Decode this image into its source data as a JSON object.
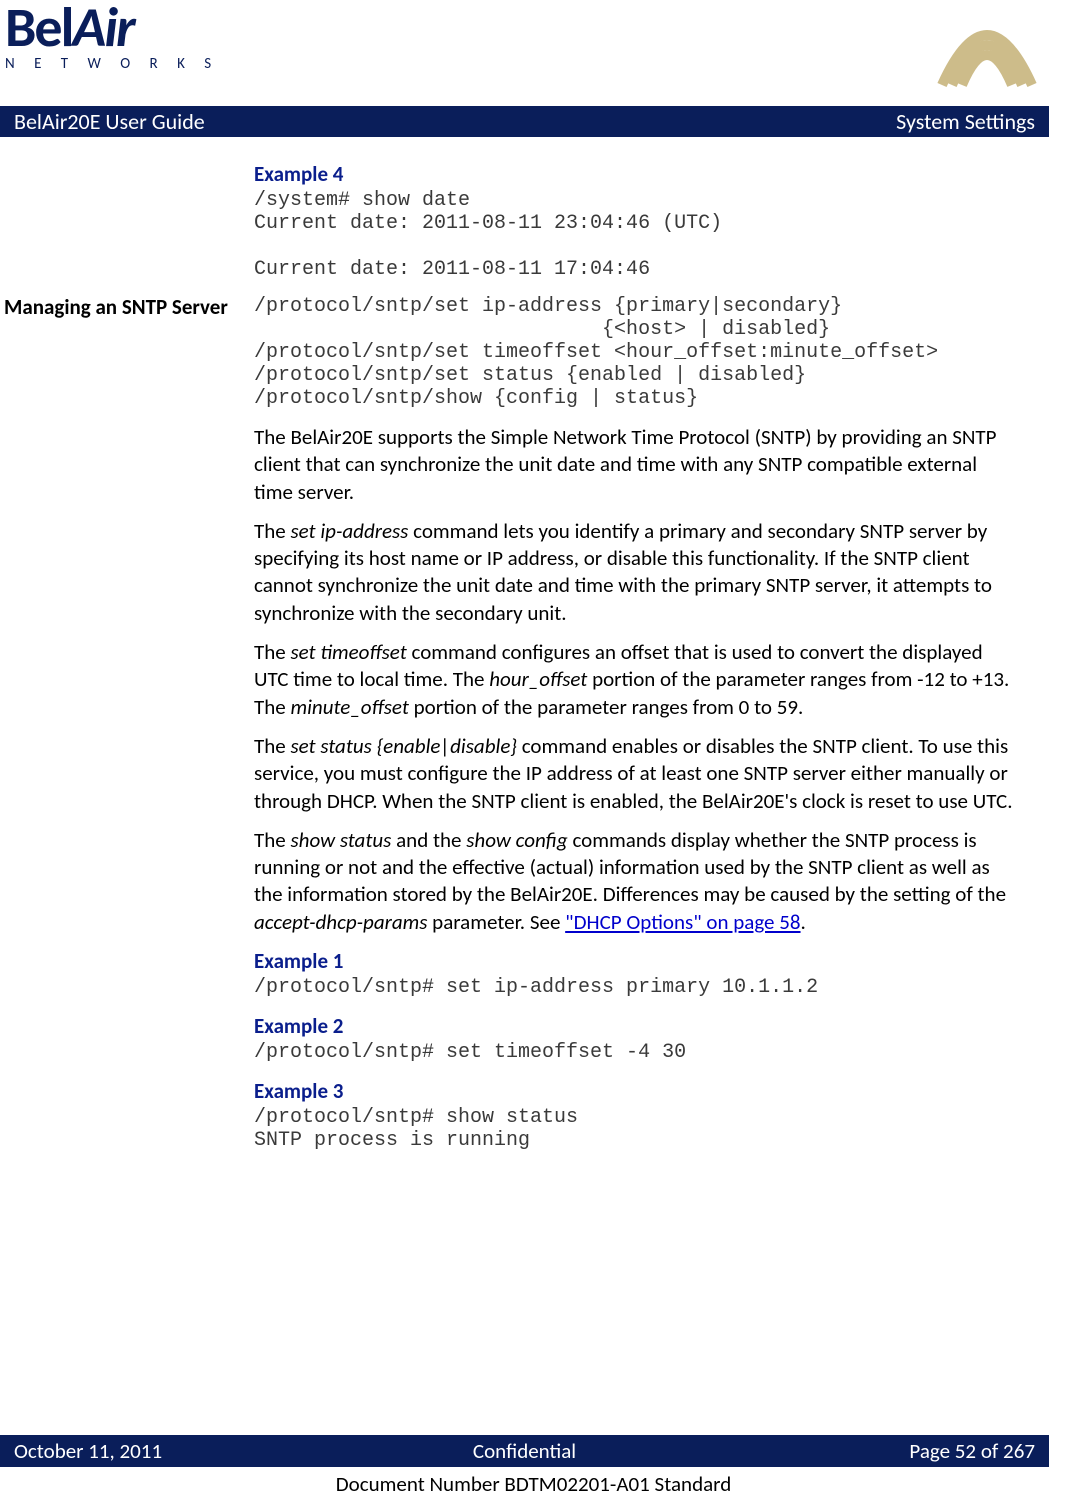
{
  "logo": {
    "line1": "BelAir",
    "line2": "N E T W O R K S"
  },
  "titlebar": {
    "left": "BelAir20E User Guide",
    "right": "System Settings"
  },
  "sidebar": {
    "managing_sntp": "Managing an SNTP Server"
  },
  "example4": {
    "title": "Example 4",
    "code": "/system# show date\nCurrent date: 2011-08-11 23:04:46 (UTC)\n\nCurrent date: 2011-08-11 17:04:46"
  },
  "sntp_syntax": "/protocol/sntp/set ip-address {primary|secondary}\n                             {<host> | disabled}\n/protocol/sntp/set timeoffset <hour_offset:minute_offset>\n/protocol/sntp/set status {enabled | disabled}\n/protocol/sntp/show {config | status}",
  "para1": "The BelAir20E supports the Simple Network Time Protocol (SNTP) by providing an SNTP client that can synchronize the unit date and time with any SNTP compatible external time server.",
  "para2_a": "The ",
  "para2_cmd": "set ip-address",
  "para2_b": " command lets you identify a primary and secondary SNTP server by specifying its host name or IP address, or disable this functionality. If the SNTP client cannot synchronize the unit date and time with the primary SNTP server, it attempts to synchronize with the secondary unit.",
  "para3_a": "The ",
  "para3_cmd1": "set timeoffset",
  "para3_b": " command configures an offset that is used to convert the displayed UTC time to local time. The ",
  "para3_cmd2": "hour_offset",
  "para3_c": " portion of the parameter ranges from -12 to +13. The ",
  "para3_cmd3": "minute_offset",
  "para3_d": " portion of the parameter ranges from 0 to 59.",
  "para4_a": "The ",
  "para4_cmd": "set status {enable|disable}",
  "para4_b": " command enables or disables the SNTP client. To use this service, you must configure the IP address of at least one SNTP server either manually or through DHCP. When the SNTP client is enabled, the BelAir20E's clock is reset to use UTC.",
  "para5_a": "The ",
  "para5_cmd1": "show status",
  "para5_b": " and the ",
  "para5_cmd2": "show config",
  "para5_c": " commands display whether the SNTP process is running or not and the effective (actual) information used by the SNTP client as well as the information stored by the BelAir20E. Differences may be caused by the setting of the ",
  "para5_cmd3": "accept-dhcp-params",
  "para5_d": " parameter. See ",
  "para5_link": "\"DHCP Options\" on page 58",
  "para5_e": ".",
  "example1": {
    "title": "Example 1",
    "code": "/protocol/sntp# set ip-address primary 10.1.1.2"
  },
  "example2": {
    "title": "Example 2",
    "code": "/protocol/sntp# set timeoffset -4 30"
  },
  "example3": {
    "title": "Example 3",
    "code": "/protocol/sntp# show status\nSNTP process is running"
  },
  "footer": {
    "date": "October 11, 2011",
    "conf": "Confidential",
    "page": "Page 52 of 267",
    "doc": "Document Number BDTM02201-A01 Standard"
  }
}
